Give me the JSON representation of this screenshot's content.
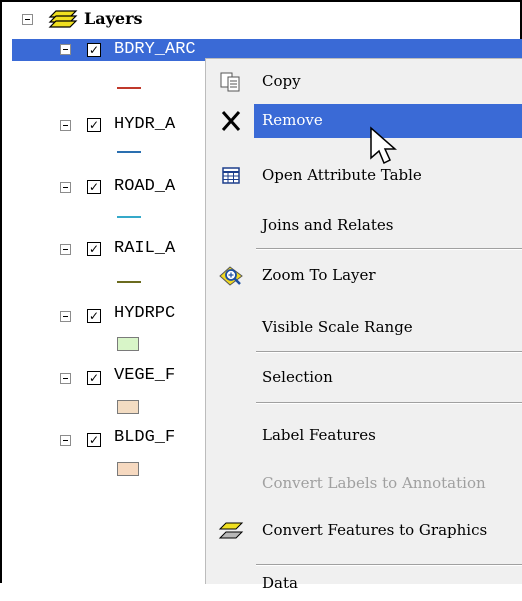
{
  "tree": {
    "root_label": "Layers",
    "layers": [
      {
        "name": "BDRY_ARC",
        "symbol": "line",
        "color": "#c0392b",
        "selected": true
      },
      {
        "name": "HYDR_A",
        "symbol": "line",
        "color": "#2a6fb0"
      },
      {
        "name": "ROAD_A",
        "symbol": "line",
        "color": "#35a9c9"
      },
      {
        "name": "RAIL_A",
        "symbol": "line",
        "color": "#6b6b1f"
      },
      {
        "name": "HYDRPC",
        "symbol": "box",
        "color": "#d8f5c8"
      },
      {
        "name": "VEGE_F",
        "symbol": "box",
        "color": "#f3dcc2"
      },
      {
        "name": "BLDG_F",
        "symbol": "box",
        "color": "#f6d9c0"
      }
    ]
  },
  "context_menu": {
    "items": [
      {
        "label": "Copy",
        "icon": "copy-icon"
      },
      {
        "label": "Remove",
        "icon": "remove-icon",
        "hover": true
      },
      {
        "label": "Open Attribute Table",
        "icon": "table-icon"
      },
      {
        "label": "Joins and Relates",
        "icon": ""
      },
      {
        "label": "Zoom To Layer",
        "icon": "zoom-to-layer-icon"
      },
      {
        "label": "Visible Scale Range",
        "icon": ""
      },
      {
        "label": "Selection",
        "icon": ""
      },
      {
        "label": "Label Features",
        "icon": ""
      },
      {
        "label": "Convert Labels to Annotation",
        "icon": "",
        "disabled": true
      },
      {
        "label": "Convert Features to Graphics",
        "icon": "convert-graphics-icon"
      },
      {
        "label": "Data",
        "icon": ""
      }
    ]
  }
}
